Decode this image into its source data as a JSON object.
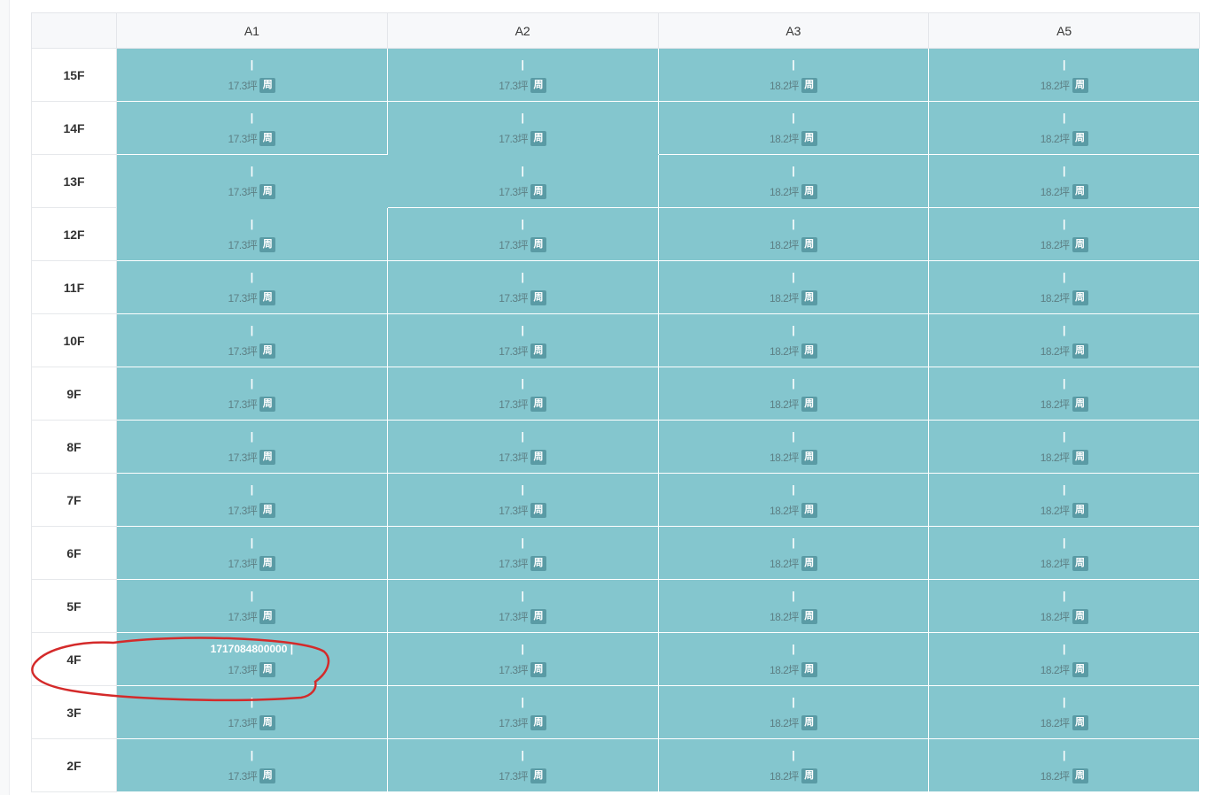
{
  "columns": [
    "A1",
    "A2",
    "A3",
    "A5"
  ],
  "floors": [
    "15F",
    "14F",
    "13F",
    "12F",
    "11F",
    "10F",
    "9F",
    "8F",
    "7F",
    "6F",
    "5F",
    "4F",
    "3F",
    "2F"
  ],
  "areas": [
    "17.3坪",
    "17.3坪",
    "18.2坪",
    "18.2坪"
  ],
  "badge": "周",
  "unit_sep": "|",
  "highlight": {
    "floor": "4F",
    "column": "A1",
    "value": "1717084800000 |"
  },
  "colors": {
    "unit_bg": "#84c6ce",
    "badge_bg": "#5a9ba5",
    "annotation_stroke": "#d42a2a"
  }
}
